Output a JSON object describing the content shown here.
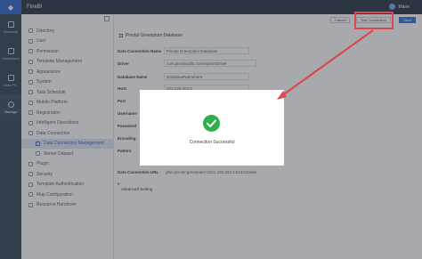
{
  "topbar": {
    "app_title": "FineBI",
    "user_name": "Marie"
  },
  "leftnav": {
    "items": [
      {
        "label": "Directory",
        "icon": "grid-icon"
      },
      {
        "label": "Dashboard",
        "icon": "dashboard-icon"
      },
      {
        "label": "Data Pr...",
        "icon": "data-prep-icon"
      },
      {
        "label": "Manage",
        "icon": "gear-icon"
      }
    ]
  },
  "sidebar": {
    "items": [
      {
        "label": "Directory"
      },
      {
        "label": "User"
      },
      {
        "label": "Permission"
      },
      {
        "label": "Template Management"
      },
      {
        "label": "Appearance"
      },
      {
        "label": "System"
      },
      {
        "label": "Task Schedule"
      },
      {
        "label": "Mobile Platform"
      },
      {
        "label": "Registration"
      },
      {
        "label": "Intelligent Operations"
      },
      {
        "label": "Data Connection"
      },
      {
        "label": "Data Connection Management"
      },
      {
        "label": "Server Dataset"
      },
      {
        "label": "Plugin"
      },
      {
        "label": "Security"
      },
      {
        "label": "Template Authentication"
      },
      {
        "label": "Map Configuration"
      },
      {
        "label": "Resource Handover"
      }
    ]
  },
  "toolbar": {
    "cancel_label": "Cancel",
    "test_connection_label": "Test Connection",
    "save_label": "Save"
  },
  "form": {
    "title": "Pivotal Greenplum Database",
    "labels": {
      "connection_name": "Data Connection Name",
      "driver": "Driver",
      "database_name": "Database Name",
      "host": "Host",
      "port": "Port",
      "username": "Username",
      "password": "Password",
      "encoding": "Encoding",
      "pattern": "Pattern",
      "url": "Data Connection URL",
      "advanced": "Advanced Setting"
    },
    "values": {
      "connection_name": "Pivotal Greenplum Database",
      "driver": "com.pivotal.jdbc.GreenplumDriver",
      "database_name": "DatabaseNamehere",
      "host": "221.228.203.3",
      "url": "jdbc:pivotal:greenplum://221.228.203.3:5432;Datab..."
    }
  },
  "dialog": {
    "message": "Connection Successful"
  },
  "colors": {
    "accent": "#2b6de0",
    "success": "#2db04b",
    "annotation": "#d9494e"
  }
}
